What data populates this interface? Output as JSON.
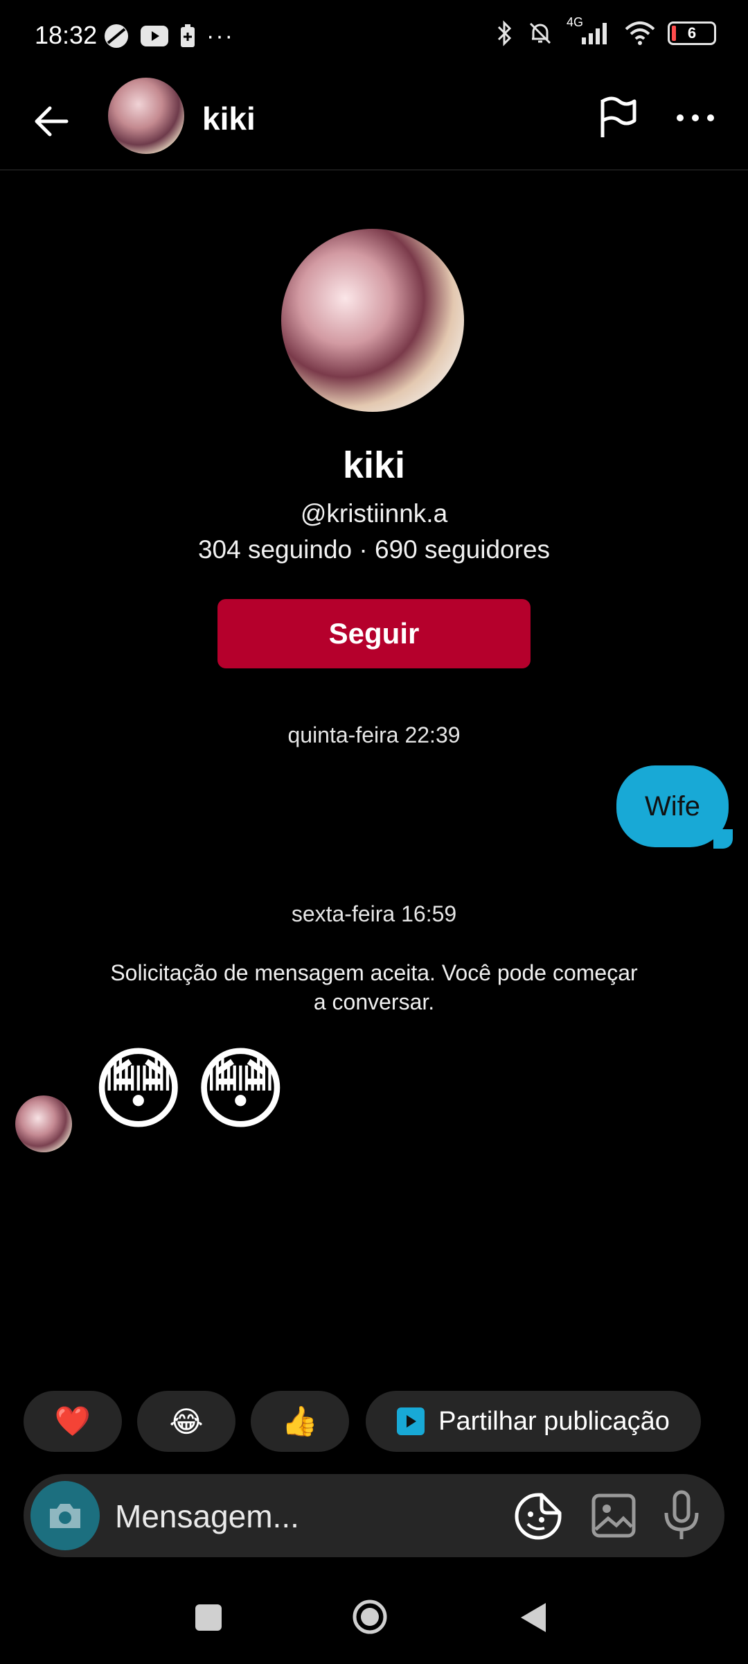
{
  "status_bar": {
    "time": "18:32",
    "network": "4G",
    "battery": "6"
  },
  "header": {
    "back_icon": "arrow-left-icon",
    "name": "kiki",
    "flag_icon": "flag-icon",
    "more_icon": "more-horizontal-icon"
  },
  "profile": {
    "name": "kiki",
    "handle": "@kristiinnk.a",
    "stats": "304 seguindo · 690 seguidores",
    "follow_label": "Seguir"
  },
  "messages": {
    "timestamp_1": "quinta-feira 22:39",
    "outgoing_text": "Wife",
    "timestamp_2": "sexta-feira 16:59",
    "system_text": "Solicitação de mensagem aceita. Você pode começar a conversar.",
    "incoming_emoji": "😳😳"
  },
  "quick_replies": {
    "heart": "❤️",
    "laugh": "😂",
    "thumbs_up": "👍",
    "share_label": "Partilhar publicação"
  },
  "composer": {
    "placeholder": "Mensagem..."
  },
  "colors": {
    "follow_button": "#b5002c",
    "outgoing_bubble": "#18a9d6",
    "chip_background": "#262626"
  }
}
